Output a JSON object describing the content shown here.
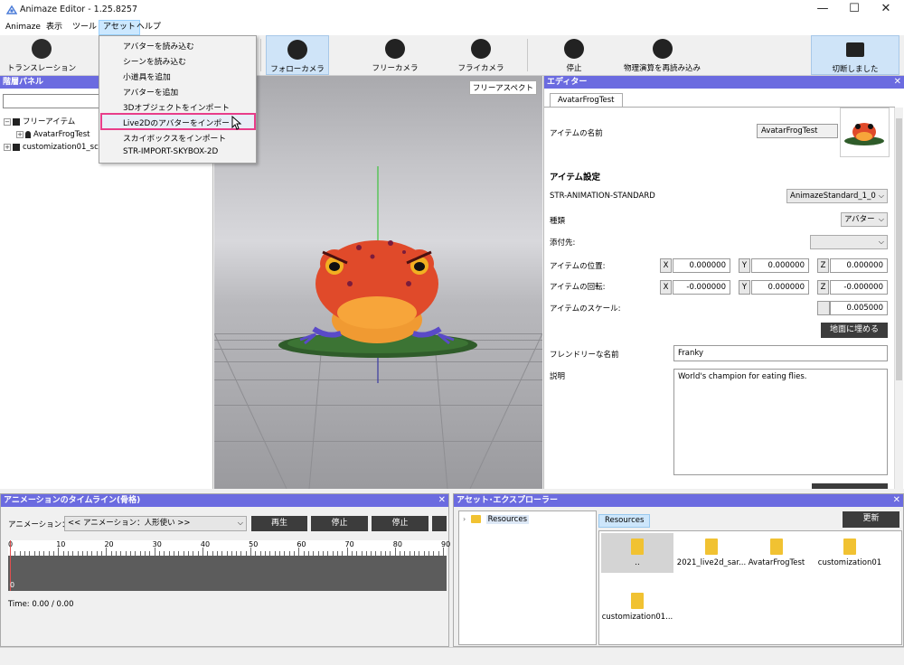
{
  "window": {
    "title": "Animaze Editor - 1.25.8257",
    "minimize": "—",
    "maximize": "☐",
    "close": "✕"
  },
  "menubar": [
    "Animaze",
    "表示",
    "ツール",
    "アセット",
    "ヘルプ"
  ],
  "dropdown": {
    "items": [
      "アバターを読み込む",
      "シーンを読み込む",
      "小道具を追加",
      "アバターを追加",
      "3Dオブジェクトをインポート",
      "Live2Dのアバターをインポート",
      "スカイボックスをインポート",
      "STR-IMPORT-SKYBOX-2D"
    ],
    "highlighted_index": 5
  },
  "toolbar": {
    "translation": "トランスレーション",
    "follow_camera": "フォローカメラ",
    "free_camera": "フリーカメラ",
    "fly_camera": "フライカメラ",
    "stop": "停止",
    "reload_physics": "物理演算を再読み込み",
    "disconnected": "切断しました"
  },
  "hierarchy": {
    "title": "階層パネル",
    "close": "✕",
    "items": [
      "フリーアイテム",
      "AvatarFrogTest",
      "customization01_sc"
    ]
  },
  "viewport": {
    "perspective_label": "フリーアスペクト"
  },
  "editor": {
    "title": "エディター",
    "close": "✕",
    "tab": "AvatarFrogTest",
    "item_name_label": "アイテムの名前",
    "item_name_value": "AvatarFrogTest",
    "item_settings": "アイテム設定",
    "anim_label": "STR-ANIMATION-STANDARD",
    "anim_value": "AnimazeStandard_1_0",
    "type_label": "種類",
    "type_value": "アバター",
    "attach_label": "添付先:",
    "position_label": "アイテムの位置:",
    "position": {
      "x": "0.000000",
      "y": "0.000000",
      "z": "0.000000"
    },
    "rotation_label": "アイテムの回転:",
    "rotation": {
      "x": "-0.000000",
      "y": "0.000000",
      "z": "-0.000000"
    },
    "scale_label": "アイテムのスケール:",
    "scale_value": "0.005000",
    "ground_button": "地面に埋める",
    "friendly_label": "フレンドリーな名前",
    "friendly_value": "Franky",
    "desc_label": "説明",
    "desc_value": "World's champion for eating flies.",
    "axis_x": "X",
    "axis_y": "Y",
    "axis_z": "Z"
  },
  "timeline": {
    "title": "アニメーションのタイムライン(骨格)",
    "close": "✕",
    "anim_label": "アニメーション：",
    "anim_value": "<< アニメーション：人形使い >>",
    "play": "再生",
    "stop1": "停止",
    "stop2": "停止",
    "ticks": [
      "0",
      "10",
      "20",
      "30",
      "40",
      "50",
      "60",
      "70",
      "80",
      "90"
    ],
    "cursor_label": "0",
    "time": "Time: 0.00 / 0.00"
  },
  "assets": {
    "title": "アセット･エクスプローラー",
    "close": "✕",
    "tree_root": "Resources",
    "breadcrumb": "Resources",
    "refresh": "更新",
    "items": [
      "..",
      "2021_live2d_sar...",
      "AvatarFrogTest",
      "customization01",
      "customization01..."
    ]
  },
  "colors": {
    "panel_header": "#6b6be0",
    "highlight_border": "#e83d8a",
    "selected_toolbar": "#cfe4f8"
  }
}
